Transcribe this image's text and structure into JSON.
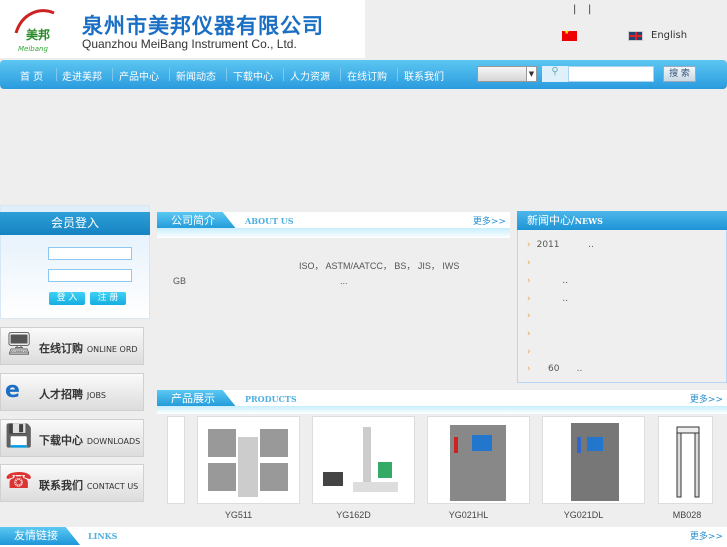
{
  "header": {
    "company_cn": "泉州市美邦仪器有限公司",
    "company_en": "Quanzhou MeiBang Instrument Co., Ltd.",
    "logo_text": "美邦 Meibang",
    "sep1": "|",
    "sep2": "|",
    "lang_en": "English"
  },
  "nav": {
    "items": [
      "首 页",
      "走进美邦",
      "产品中心",
      "新闻动态",
      "下载中心",
      "人力资源",
      "在线订购",
      "联系我们"
    ],
    "search_button": "搜 索"
  },
  "login": {
    "title": "会员登入",
    "login_button": "登 入",
    "register_button": "注 册"
  },
  "about": {
    "title": "公司简介",
    "subtitle": "ABOUT US",
    "more": "更多>>",
    "line1": "ISO， ASTM/AATCC， BS， JIS， IWS",
    "line2": "GB",
    "ellipsis": "..."
  },
  "news": {
    "title": "新闻中心/",
    "subtitle": "NEWS",
    "items": [
      "2011          ..",
      "",
      "         ..",
      "         ..",
      "",
      "",
      "",
      "    60      .."
    ]
  },
  "side_links": [
    {
      "cn": "在线订购",
      "en": "ONLINE ORD"
    },
    {
      "cn": "人才招聘",
      "en": "JOBS"
    },
    {
      "cn": "下载中心",
      "en": "DOWNLOADS"
    },
    {
      "cn": "联系我们",
      "en": "CONTACT US"
    }
  ],
  "products": {
    "title": "产品展示",
    "subtitle": "PRODUCTS",
    "more": "更多>>",
    "items": [
      "YG511",
      "YG162D",
      "YG021HL",
      "YG021DL",
      "MB028"
    ]
  },
  "links": {
    "title": "友情链接",
    "subtitle": "LINKS",
    "more": "更多>>"
  },
  "colors": {
    "nav": "#2a9bde",
    "accent": "#1e96d8",
    "title": "#1a6fc4"
  }
}
